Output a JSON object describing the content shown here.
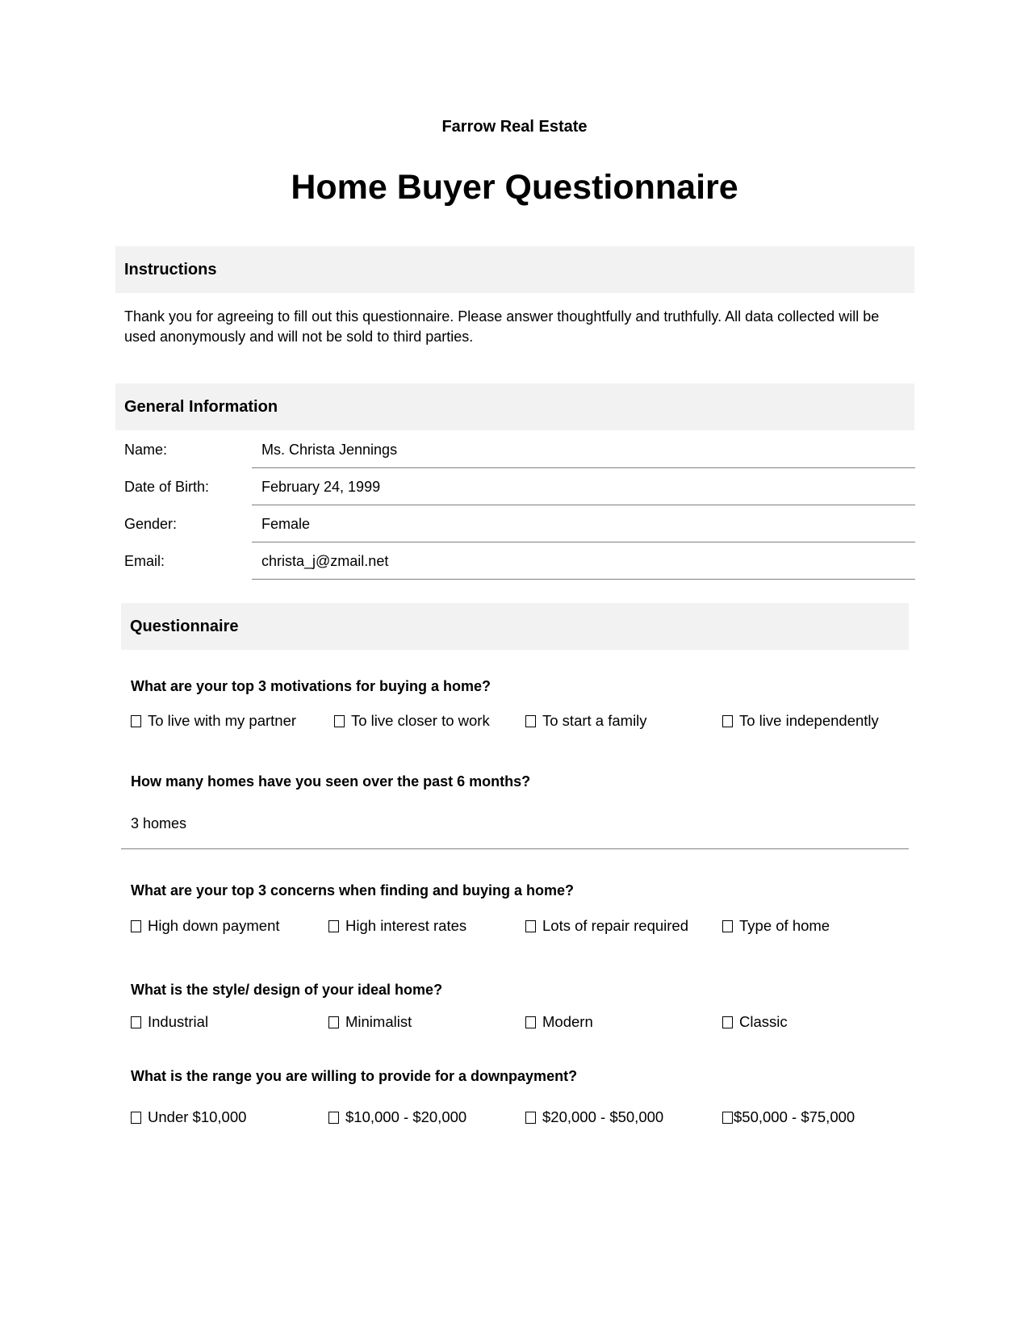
{
  "header": {
    "company": "Farrow Real Estate",
    "title": "Home Buyer Questionnaire"
  },
  "instructions": {
    "heading": "Instructions",
    "text": "Thank you for agreeing to fill out this questionnaire. Please answer thoughtfully and truthfully. All data collected will be used anonymously and will not be sold to third parties."
  },
  "general_info": {
    "heading": "General Information",
    "fields": [
      {
        "label": "Name:",
        "value": "Ms. Christa Jennings"
      },
      {
        "label": "Date of Birth:",
        "value": "February 24, 1999"
      },
      {
        "label": "Gender:",
        "value": "Female"
      },
      {
        "label": "Email:",
        "value": "christa_j@zmail.net"
      }
    ]
  },
  "questionnaire": {
    "heading": "Questionnaire",
    "questions": [
      {
        "question": "What are your top 3 motivations for buying a home?",
        "options": [
          "To live with my partner",
          "To live closer to work",
          "To start a family",
          "To live independently"
        ],
        "checked": [
          false,
          false,
          false,
          false
        ]
      },
      {
        "question": "How many homes have you seen over the past 6 months?",
        "answer": "3 homes"
      },
      {
        "question": "What are your top 3 concerns when finding and buying a home?",
        "options": [
          "High down payment",
          "High interest rates",
          "Lots of repair required",
          "Type of home"
        ],
        "checked": [
          false,
          false,
          false,
          false
        ]
      },
      {
        "question": "What is the style/ design of your ideal home?",
        "options": [
          "Industrial",
          "Minimalist",
          "Modern",
          "Classic"
        ],
        "checked": [
          false,
          false,
          false,
          false
        ]
      },
      {
        "question": "What is the range you are willing to provide for a downpayment?",
        "options": [
          "Under $10,000",
          "$10,000 - $20,000",
          "$20,000 - $50,000",
          "$50,000 - $75,000"
        ],
        "checked": [
          false,
          false,
          false,
          false
        ]
      }
    ]
  }
}
